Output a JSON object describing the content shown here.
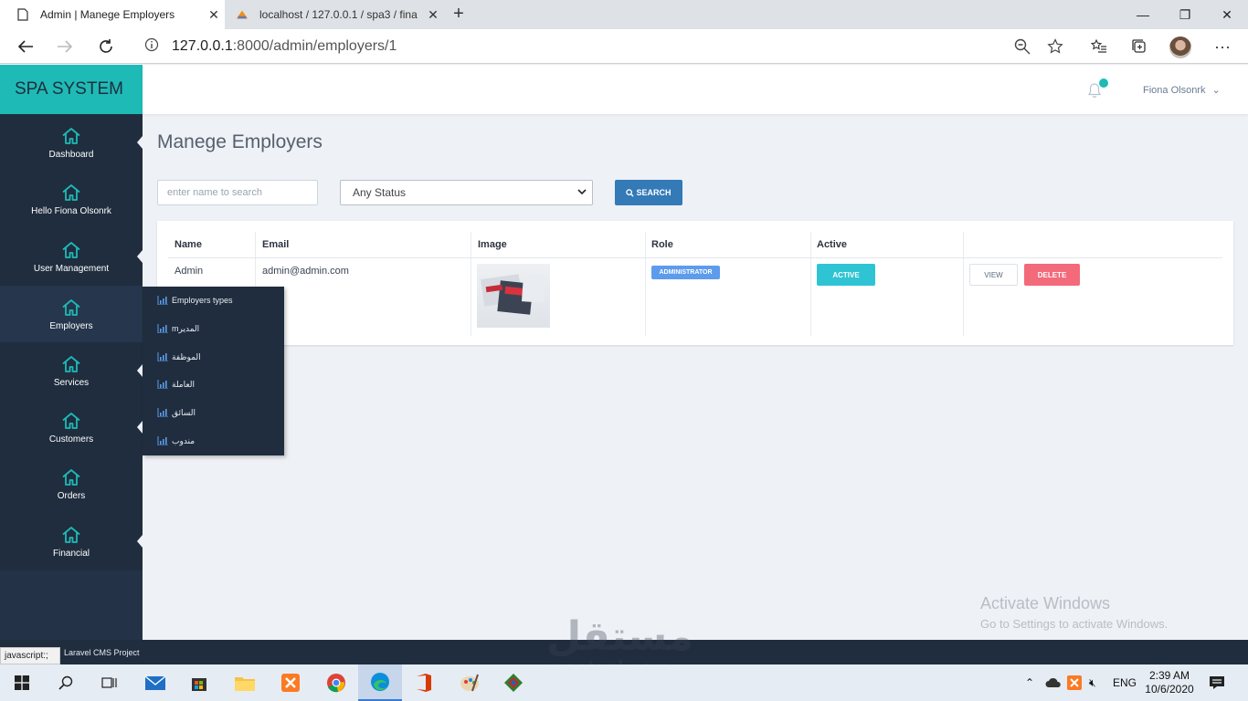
{
  "browser": {
    "tabs": [
      {
        "title": "Admin | Manege Employers",
        "active": true
      },
      {
        "title": "localhost / 127.0.0.1 / spa3 / fina",
        "active": false
      }
    ],
    "url_host": "127.0.0.1",
    "url_rest": ":8000/admin/employers/1"
  },
  "app": {
    "brand": "SPA SYSTEM",
    "accent_color": "#1ebab6",
    "sidebar": {
      "items": [
        {
          "label": "Dashboard",
          "icon": "home-icon"
        },
        {
          "label": "Hello Fiona Olsonrk",
          "icon": "home-icon"
        },
        {
          "label": "User Management",
          "icon": "home-icon"
        },
        {
          "label": "Employers",
          "icon": "home-icon",
          "active": true
        },
        {
          "label": "Services",
          "icon": "home-icon"
        },
        {
          "label": "Customers",
          "icon": "home-icon"
        },
        {
          "label": "Orders",
          "icon": "home-icon"
        },
        {
          "label": "Financial",
          "icon": "home-icon"
        }
      ]
    },
    "flyout": {
      "items": [
        {
          "label": "Employers types"
        },
        {
          "label": "mالمدير"
        },
        {
          "label": "الموظفة"
        },
        {
          "label": "العاملة"
        },
        {
          "label": "السائق"
        },
        {
          "label": "مندوب"
        }
      ]
    },
    "topbar": {
      "user_name": "Fiona Olsonrk",
      "user_caret": "⌄"
    },
    "page_title": "Manege Employers",
    "filters": {
      "search_placeholder": "enter name to search",
      "status_value": "Any Status",
      "search_button": "SEARCH"
    },
    "table": {
      "headers": [
        "Name",
        "Email",
        "Image",
        "Role",
        "Active"
      ],
      "rows": [
        {
          "name": "Admin",
          "email": "admin@admin.com",
          "role": "ADMINISTRATOR",
          "active": "ACTIVE",
          "view": "VIEW",
          "delete": "DELETE"
        }
      ]
    },
    "footer": {
      "text": "Laravel CMS Project",
      "status_tooltip": "javascript:;"
    }
  },
  "overlay": {
    "activate_title": "Activate Windows",
    "activate_sub": "Go to Settings to activate Windows.",
    "watermark_arabic": "مستقل",
    "watermark_latin": "mostaql.com"
  },
  "taskbar": {
    "lang": "ENG",
    "time": "2:39 AM",
    "date": "10/6/2020"
  }
}
